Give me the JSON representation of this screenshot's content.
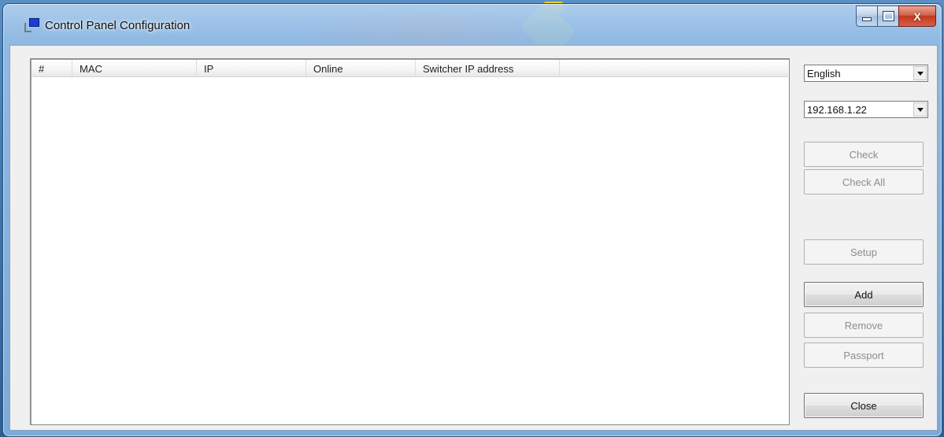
{
  "window": {
    "title": "Control Panel Configuration",
    "close_glyph": "X"
  },
  "table": {
    "columns": [
      "#",
      "MAC",
      "IP",
      "Online",
      "Switcher IP address"
    ],
    "rows": []
  },
  "language_select": {
    "value": "English"
  },
  "ip_select": {
    "value": "192.168.1.22"
  },
  "buttons": {
    "check": {
      "label": "Check",
      "enabled": false
    },
    "check_all": {
      "label": "Check All",
      "enabled": false
    },
    "setup": {
      "label": "Setup",
      "enabled": false
    },
    "add": {
      "label": "Add",
      "enabled": true
    },
    "remove": {
      "label": "Remove",
      "enabled": false
    },
    "passport": {
      "label": "Passport",
      "enabled": false
    },
    "close": {
      "label": "Close",
      "enabled": true
    }
  },
  "icons": {
    "app": "app-icon",
    "minimize": "minimize-icon",
    "maximize": "maximize-icon",
    "close": "close-icon",
    "dropdown": "chevron-down-icon"
  },
  "colors": {
    "close_button": "#c2381f",
    "window_frame": "#96bee6",
    "client_bg": "#f0f0f0"
  }
}
